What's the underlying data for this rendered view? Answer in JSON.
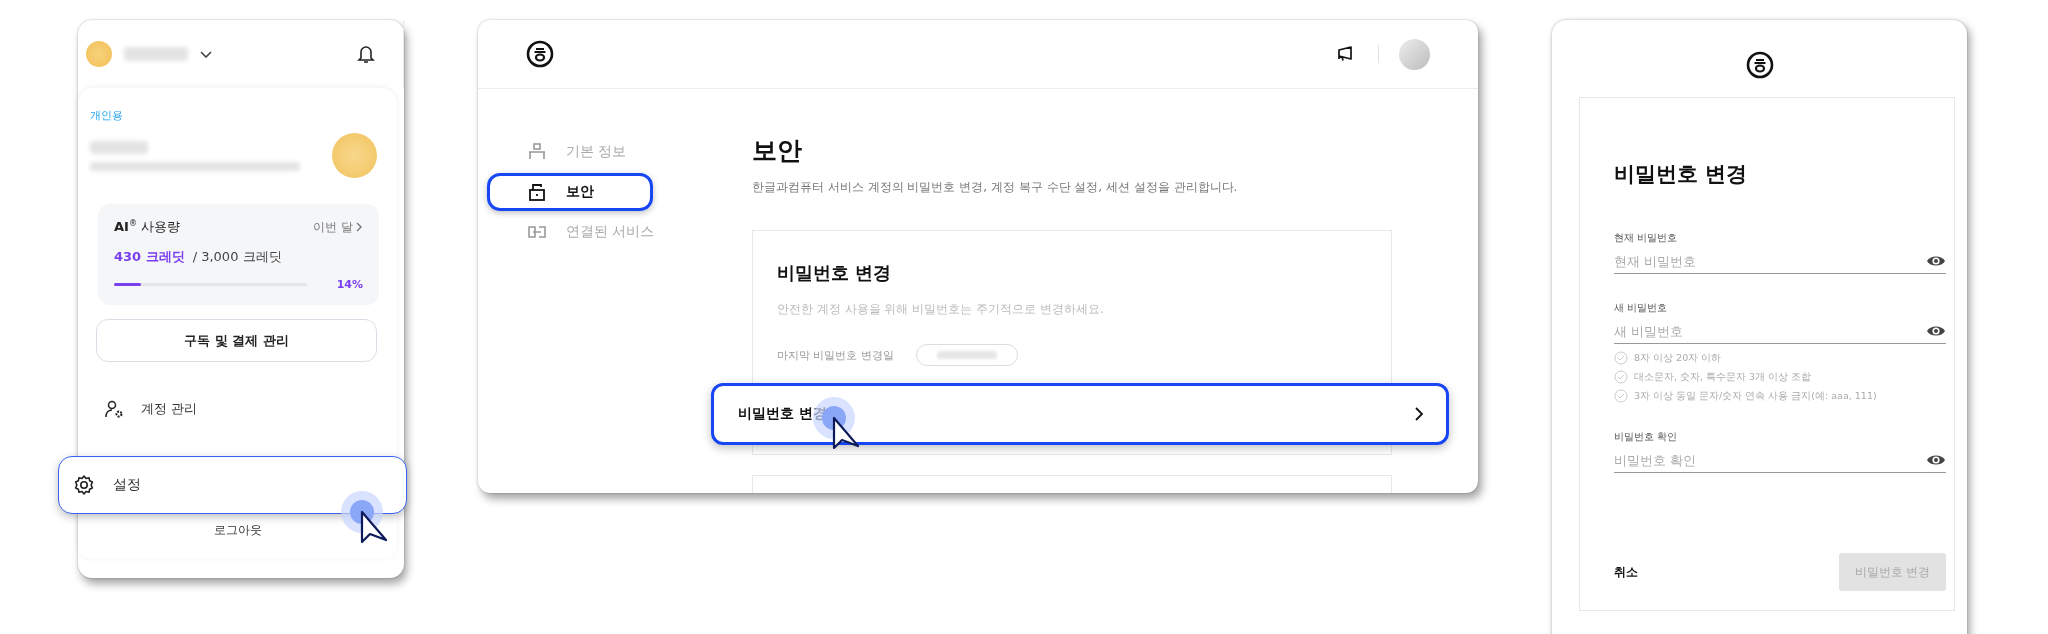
{
  "account_menu": {
    "section_label": "개인용",
    "usage": {
      "title": "**AI**$^{®}$ 사용량",
      "period": "이번 달",
      "used": "430 크레딧",
      "total": "/ 3,000 크레딧",
      "level": 0.14,
      "percent": "14%"
    },
    "subscription_button": "구독 및 결제 관리",
    "items": [
      {
        "kind": "account",
        "label": "계정 관리",
        "selected": false
      },
      {
        "kind": "settings",
        "label": "설정",
        "selected": true
      }
    ],
    "logout": "로그아웃"
  },
  "security_page": {
    "nav": [
      {
        "kind": "profile",
        "label": "기본 정보",
        "selected": false
      },
      {
        "kind": "lock",
        "label": "보안",
        "selected": true
      },
      {
        "kind": "link",
        "label": "연결된 서비스",
        "selected": false
      }
    ],
    "heading": "보안",
    "description": "한글과컴퓨터 서비스 계정의 비밀번호 변경, 계정 복구 수단 설정, 세션 설정을 관리합니다.",
    "card": {
      "title": "비밀번호 변경",
      "description": "안전한 계정 사용을 위해 비밀번호는 주기적으로 변경하세요.",
      "last_changed_label": "마지막 비밀번호 변경일",
      "action": {
        "label": "비밀번호 변경",
        "selected": true
      }
    }
  },
  "password_form": {
    "title": "비밀번호 변경",
    "fields": [
      {
        "label": "현재 비밀번호",
        "placeholder": "현재 비밀번호"
      },
      {
        "label": "새 비밀번호",
        "placeholder": "새 비밀번호",
        "rules": [
          {
            "text": "8자 이상 20자 이하",
            "checked": false
          },
          {
            "text": "대소문자, 숫자, 특수문자 3개 이상 조합",
            "checked": false
          },
          {
            "text": "3자 이상 동일 문자/숫자 연속 사용 금지(예: aaa, 111)",
            "checked": false
          }
        ]
      },
      {
        "label": "비밀번호 확인",
        "placeholder": "비밀번호 확인"
      }
    ],
    "cancel": "취소",
    "submit": {
      "label": "비밀번호 변경",
      "disabled": true
    }
  }
}
